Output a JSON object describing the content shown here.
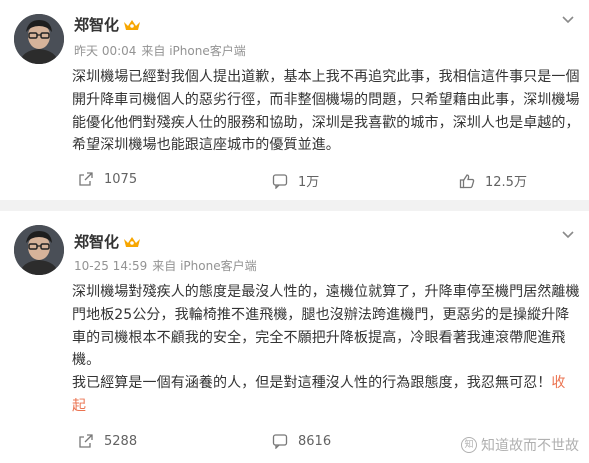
{
  "posts": [
    {
      "author": "郑智化",
      "time": "昨天 00:04",
      "source": "来自 iPhone客户端",
      "lines": [
        "深圳機場已經對我個人提出道歉，基本上我不再追究此事，我相信這件事只是一個",
        "開升降車司機個人的惡劣行徑，而非整個機場的問題，只希望藉由此事，深圳機場",
        "能優化他們對殘疾人仕的服務和協助，深圳是我喜歡的城市，深圳人也是卓越的，",
        "希望深圳機場也能跟這座城市的優質並進。"
      ],
      "reposts": "1075",
      "comments": "1万",
      "likes": "12.5万"
    },
    {
      "author": "郑智化",
      "time": "10-25 14:59",
      "source": "来自 iPhone客户端",
      "lines": [
        "深圳機場對殘疾人的態度是最沒人性的，遠機位就算了，升降車停至機門居然離機",
        "門地板25公分，我輪椅推不進飛機，腿也沒辦法跨進機門，更惡劣的是操縱升降",
        "車的司機根本不顧我的安全，完全不願把升降板提高，冷眼看著我連滾帶爬進飛",
        "機。",
        "我已經算是一個有涵養的人，但是對這種沒人性的行為跟態度，我忍無可忍！"
      ],
      "fold_part1": "收",
      "fold_part2": "起",
      "reposts": "5288",
      "comments": "8616"
    }
  ],
  "watermark": "知道故而不世故",
  "watermark_icon": "知",
  "colors": {
    "text": "#333333",
    "meta": "#939393",
    "fold": "#eb7350",
    "background": "#f2f2f2",
    "badge": "#f7a600"
  },
  "icons": {
    "repost": "repost-icon",
    "comment": "comment-icon",
    "like": "thumbs-up-icon",
    "menu": "chevron-down-icon",
    "badge": "crown-badge-icon"
  }
}
